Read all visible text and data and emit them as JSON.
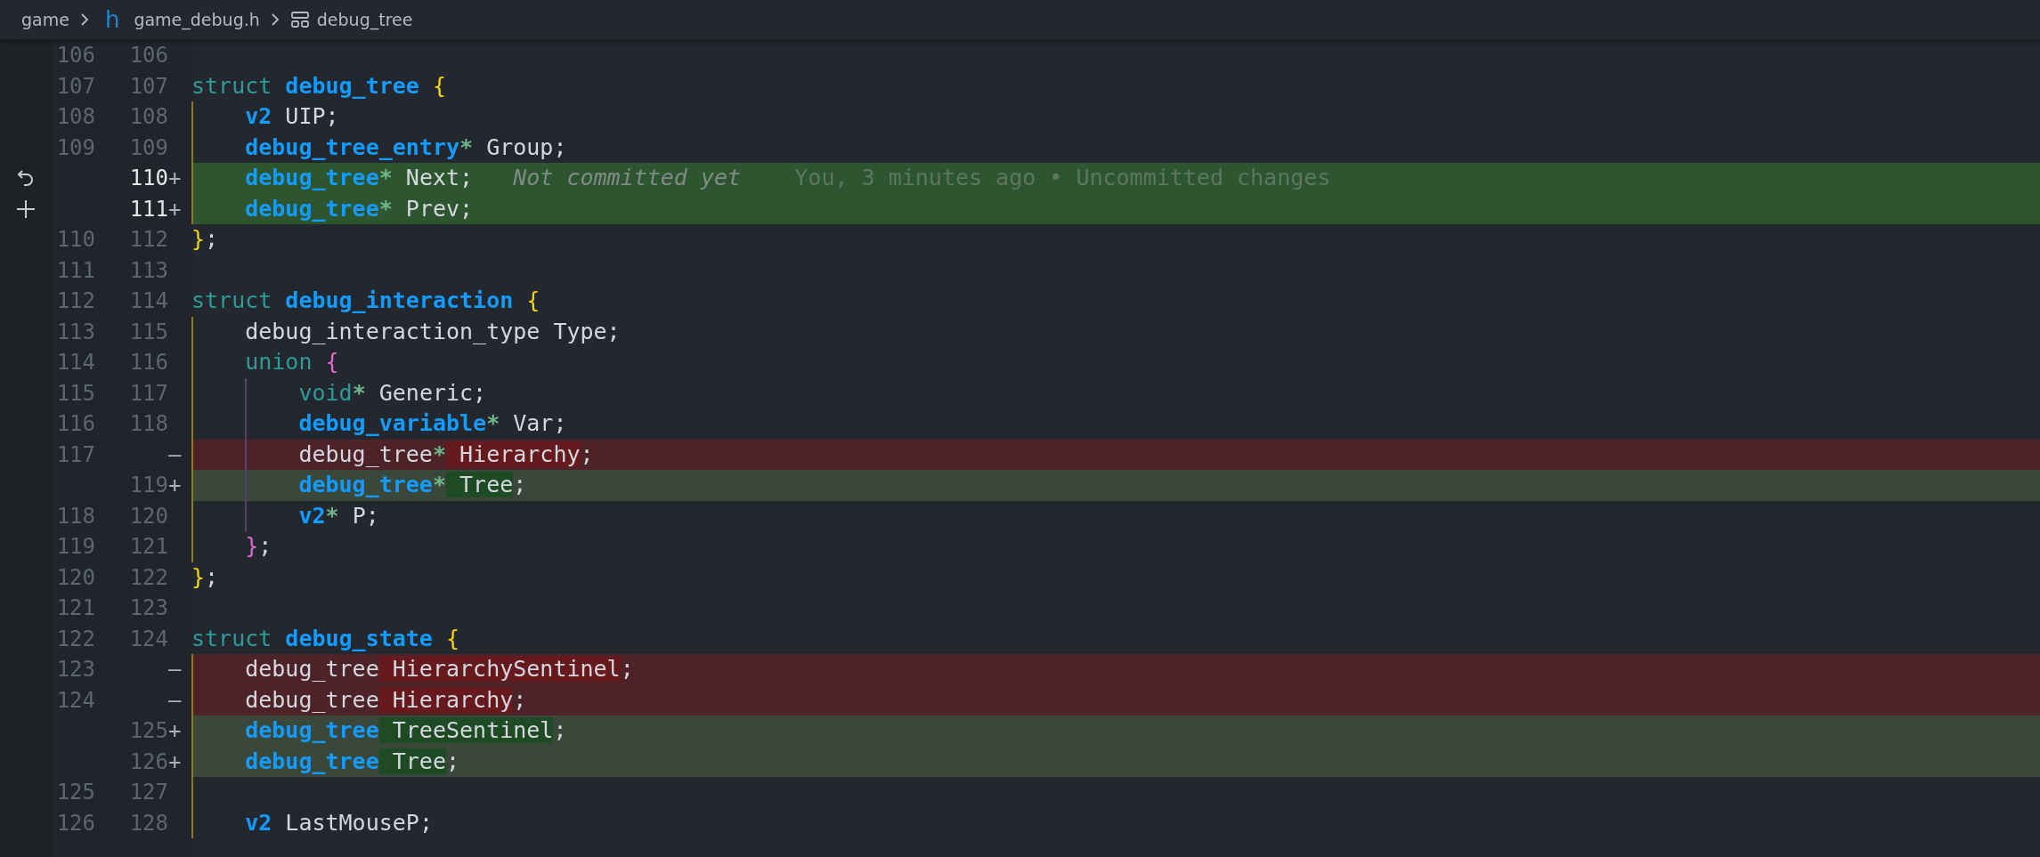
{
  "breadcrumb": [
    {
      "kind": "folder",
      "label": "game"
    },
    {
      "kind": "file",
      "icon_text": "h",
      "label": "game_debug.h"
    },
    {
      "kind": "symbol",
      "label": "debug_tree"
    }
  ],
  "rows": [
    {
      "old": "106",
      "new": "106",
      "kind": "context"
    },
    {
      "old": "107",
      "new": "107",
      "kind": "context",
      "code": [
        {
          "kind": "kw",
          "t": "struct "
        },
        {
          "kind": "type",
          "t": "debug_tree"
        },
        {
          "kind": "brace1",
          "t": " {"
        }
      ]
    },
    {
      "old": "108",
      "new": "108",
      "kind": "context",
      "code": [
        {
          "kind": "type",
          "t": "    v2"
        },
        {
          "kind": "id",
          "t": " UIP;"
        }
      ]
    },
    {
      "old": "109",
      "new": "109",
      "kind": "context",
      "code": [
        {
          "kind": "type",
          "t": "    debug_tree_entry"
        },
        {
          "kind": "star",
          "t": "*"
        },
        {
          "kind": "id",
          "t": " Group;"
        }
      ]
    },
    {
      "new": "110",
      "sign": "+",
      "kind": "added",
      "highlighted": true,
      "gutter": {
        "kind": "revert"
      },
      "code": [
        {
          "kind": "type",
          "t": "    debug_tree"
        },
        {
          "kind": "star",
          "t": "*"
        },
        {
          "kind": "id",
          "t": " Next;"
        }
      ],
      "annotation": {
        "note": "Not committed yet",
        "blame": "You, 3 minutes ago • Uncommitted changes"
      }
    },
    {
      "new": "111",
      "sign": "+",
      "kind": "added",
      "highlighted": true,
      "gutter": {
        "kind": "stage"
      },
      "code": [
        {
          "kind": "type",
          "t": "    debug_tree"
        },
        {
          "kind": "star",
          "t": "*"
        },
        {
          "kind": "id",
          "t": " Prev;"
        }
      ]
    },
    {
      "old": "110",
      "new": "112",
      "kind": "context",
      "code": [
        {
          "kind": "brace1",
          "t": "}"
        },
        {
          "kind": "id",
          "t": ";"
        }
      ]
    },
    {
      "old": "111",
      "new": "113",
      "kind": "context"
    },
    {
      "old": "112",
      "new": "114",
      "kind": "context",
      "code": [
        {
          "kind": "kw",
          "t": "struct "
        },
        {
          "kind": "type",
          "t": "debug_interaction"
        },
        {
          "kind": "brace1",
          "t": " {"
        }
      ]
    },
    {
      "old": "113",
      "new": "115",
      "kind": "context",
      "code": [
        {
          "kind": "id",
          "t": "    debug_interaction_type Type;"
        }
      ]
    },
    {
      "old": "114",
      "new": "116",
      "kind": "context",
      "code": [
        {
          "kind": "kw",
          "t": "    union "
        },
        {
          "kind": "brace2",
          "t": "{"
        }
      ]
    },
    {
      "old": "115",
      "new": "117",
      "kind": "context",
      "code": [
        {
          "kind": "kw",
          "t": "        void"
        },
        {
          "kind": "star",
          "t": "*"
        },
        {
          "kind": "id",
          "t": " Generic;"
        }
      ]
    },
    {
      "old": "116",
      "new": "118",
      "kind": "context",
      "code": [
        {
          "kind": "type",
          "t": "        debug_variable"
        },
        {
          "kind": "star",
          "t": "*"
        },
        {
          "kind": "id",
          "t": " Var;"
        }
      ]
    },
    {
      "old": "117",
      "sign": "—",
      "kind": "removed",
      "code": [
        {
          "kind": "id",
          "t": "        debug_tree"
        },
        {
          "kind": "star",
          "t": "*"
        },
        {
          "kind": "changed",
          "t": " Hierarchy"
        },
        {
          "kind": "id",
          "t": ";"
        }
      ]
    },
    {
      "new": "119",
      "sign": "+",
      "kind": "added",
      "highlighted": false,
      "code": [
        {
          "kind": "type",
          "t": "        debug_tree"
        },
        {
          "kind": "star",
          "t": "*"
        },
        {
          "kind": "changed",
          "t": " Tree"
        },
        {
          "kind": "id",
          "t": ";"
        }
      ]
    },
    {
      "old": "118",
      "new": "120",
      "kind": "context",
      "code": [
        {
          "kind": "type",
          "t": "        v2"
        },
        {
          "kind": "star",
          "t": "*"
        },
        {
          "kind": "id",
          "t": " P;"
        }
      ]
    },
    {
      "old": "119",
      "new": "121",
      "kind": "context",
      "code": [
        {
          "kind": "brace2",
          "t": "    }"
        },
        {
          "kind": "id",
          "t": ";"
        }
      ]
    },
    {
      "old": "120",
      "new": "122",
      "kind": "context",
      "code": [
        {
          "kind": "brace1",
          "t": "}"
        },
        {
          "kind": "id",
          "t": ";"
        }
      ]
    },
    {
      "old": "121",
      "new": "123",
      "kind": "context"
    },
    {
      "old": "122",
      "new": "124",
      "kind": "context",
      "code": [
        {
          "kind": "kw",
          "t": "struct "
        },
        {
          "kind": "type",
          "t": "debug_state"
        },
        {
          "kind": "brace1",
          "t": " {"
        }
      ]
    },
    {
      "old": "123",
      "sign": "—",
      "kind": "removed",
      "code": [
        {
          "kind": "id",
          "t": "    debug_tree"
        },
        {
          "kind": "changed",
          "t": " HierarchySentinel"
        },
        {
          "kind": "id",
          "t": ";"
        }
      ]
    },
    {
      "old": "124",
      "sign": "—",
      "kind": "removed",
      "code": [
        {
          "kind": "id",
          "t": "    debug_tree"
        },
        {
          "kind": "changed",
          "t": " Hierarchy"
        },
        {
          "kind": "id",
          "t": ";"
        }
      ]
    },
    {
      "new": "125",
      "sign": "+",
      "kind": "added",
      "highlighted": false,
      "code": [
        {
          "kind": "type",
          "t": "    debug_tree"
        },
        {
          "kind": "changed",
          "t": " TreeSentinel"
        },
        {
          "kind": "id",
          "t": ";"
        }
      ]
    },
    {
      "new": "126",
      "sign": "+",
      "kind": "added",
      "highlighted": false,
      "code": [
        {
          "kind": "type",
          "t": "    debug_tree"
        },
        {
          "kind": "changed",
          "t": " Tree"
        },
        {
          "kind": "id",
          "t": ";"
        }
      ]
    },
    {
      "old": "125",
      "new": "127",
      "kind": "context"
    },
    {
      "old": "126",
      "new": "128",
      "kind": "context",
      "code": [
        {
          "kind": "type",
          "t": "    v2"
        },
        {
          "kind": "id",
          "t": " LastMouseP;"
        }
      ]
    }
  ]
}
